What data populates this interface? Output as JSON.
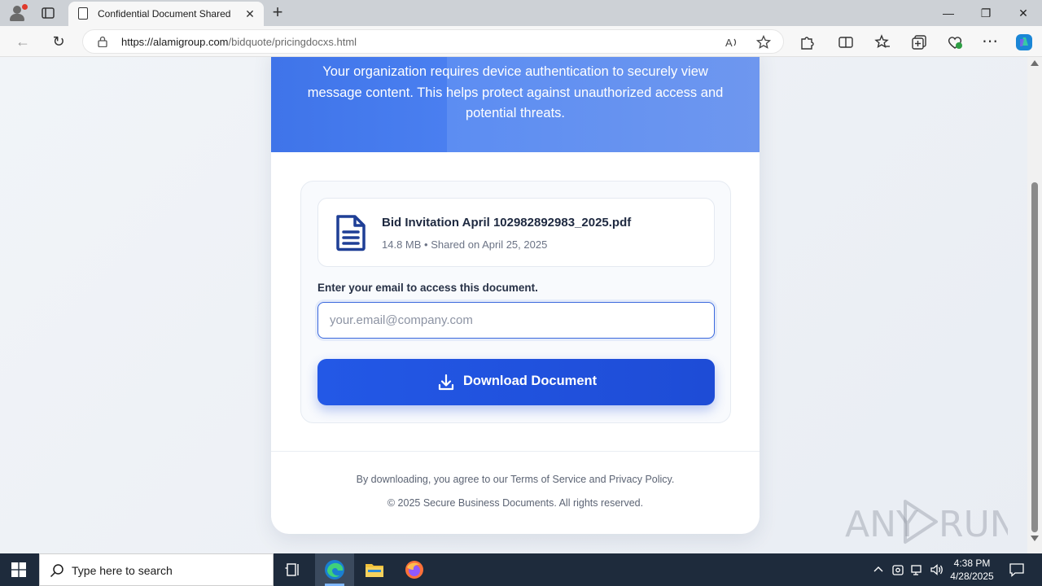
{
  "browser": {
    "tab_title": "Confidential Document Shared",
    "close_tab_symbol": "✕",
    "new_tab_symbol": "+",
    "url_host": "https://alamigroup.com",
    "url_path": "/bidquote/pricingdocxs.html",
    "window_controls": {
      "minimize": "—",
      "restore": "❐",
      "close": "✕"
    },
    "nav": {
      "back": "←",
      "refresh": "↻",
      "more": "⋯"
    }
  },
  "page": {
    "intro": "Your organization requires device authentication to securely view message content. This helps protect against unauthorized access and potential threats.",
    "file": {
      "name": "Bid Invitation April 102982892983_2025.pdf",
      "meta": "14.8 MB • Shared on April 25, 2025",
      "icon": "document-icon"
    },
    "email_label": "Enter your email to access this document.",
    "email_placeholder": "your.email@company.com",
    "email_value": "",
    "download_label": "Download Document",
    "legal_prefix": "By downloading, you agree to our ",
    "terms_link": "Terms of Service",
    "legal_and": " and ",
    "privacy_link": "Privacy Policy",
    "legal_suffix": ".",
    "copyright": "© 2025 Secure Business Documents. All rights reserved.",
    "colors": {
      "primary": "#1e4cd6",
      "hero": "#4a7ff0",
      "icon": "#1f3f96"
    }
  },
  "watermark": {
    "text": "ANY RUN"
  },
  "taskbar": {
    "search_placeholder": "Type here to search",
    "time": "4:38 PM",
    "date": "4/28/2025",
    "apps": [
      "task-view-icon",
      "edge-icon",
      "file-explorer-icon",
      "firefox-icon"
    ]
  }
}
